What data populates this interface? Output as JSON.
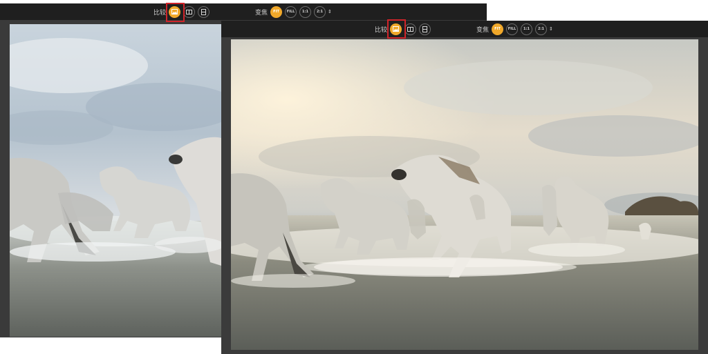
{
  "back_window": {
    "toolbar": {
      "compare_label": "比较",
      "zoom_label": "变焦",
      "zoom_buttons": [
        "FIT",
        "FILL",
        "1:1",
        "2:1"
      ],
      "stepper_glyph": "⇕"
    }
  },
  "front_window": {
    "toolbar": {
      "compare_label": "比较",
      "zoom_label": "变焦",
      "zoom_buttons": [
        "FIT",
        "FILL",
        "1:1",
        "2:1"
      ],
      "stepper_glyph": "⇕"
    }
  },
  "icons": {
    "compare_single": "single-image-icon",
    "compare_side_by_side": "side-by-side-icon",
    "compare_split": "split-view-icon",
    "stepper": "up-down-arrows-icon"
  },
  "colors": {
    "accent": "#f0a82a",
    "highlight": "#d0242a",
    "toolbar_bg": "#1f1f1f",
    "panel_bg": "#3a3a3a"
  },
  "active_zoom": "FIT"
}
